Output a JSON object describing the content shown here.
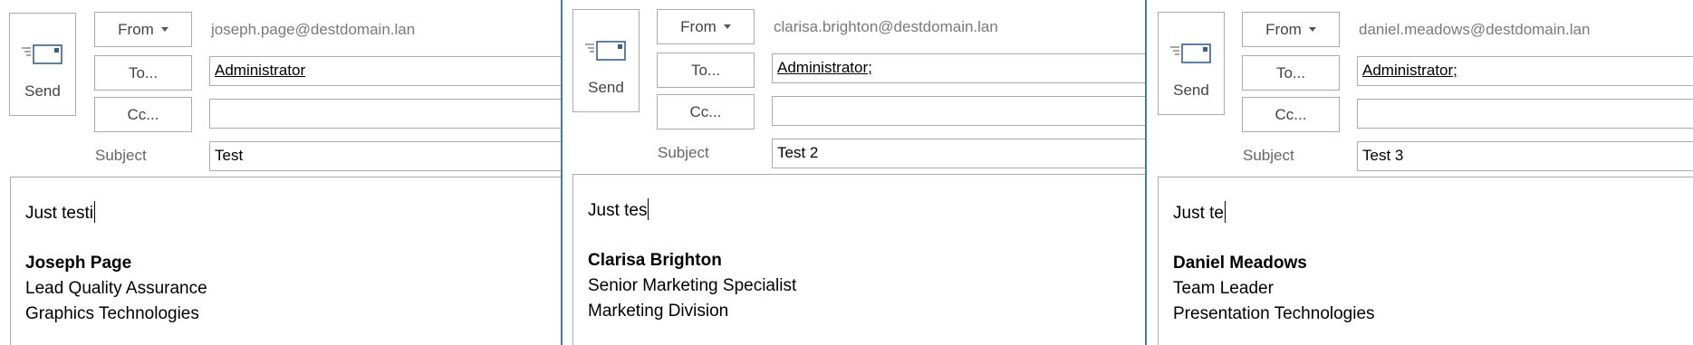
{
  "compose_windows": [
    {
      "send_label": "Send",
      "from_label": "From",
      "from_address": "joseph.page@destdomain.lan",
      "to_label": "To...",
      "to_value": "Administrator",
      "cc_label": "Cc...",
      "cc_value": "",
      "subject_label": "Subject",
      "subject_value": "Test",
      "body_text": "Just testi",
      "signature": {
        "name": "Joseph Page",
        "title": "Lead Quality Assurance",
        "department": "Graphics Technologies"
      }
    },
    {
      "send_label": "Send",
      "from_label": "From",
      "from_address": "clarisa.brighton@destdomain.lan",
      "to_label": "To...",
      "to_value": "Administrator;",
      "cc_label": "Cc...",
      "cc_value": "",
      "subject_label": "Subject",
      "subject_value": "Test 2",
      "body_text": "Just tes",
      "signature": {
        "name": "Clarisa Brighton",
        "title": "Senior Marketing Specialist",
        "department": "Marketing Division"
      }
    },
    {
      "send_label": "Send",
      "from_label": "From",
      "from_address": "daniel.meadows@destdomain.lan",
      "to_label": "To...",
      "to_value": "Administrator;",
      "cc_label": "Cc...",
      "cc_value": "",
      "subject_label": "Subject",
      "subject_value": "Test 3",
      "body_text": "Just te",
      "signature": {
        "name": "Daniel Meadows",
        "title": "Team Leader",
        "department": "Presentation Technologies"
      }
    }
  ],
  "colors": {
    "divider": "#3d7ab8",
    "border": "#ababab",
    "label_text": "#444444",
    "from_text": "#7a7a7a"
  },
  "icons": {
    "send": "envelope-send-icon",
    "from_menu": "chevron-down-icon"
  }
}
